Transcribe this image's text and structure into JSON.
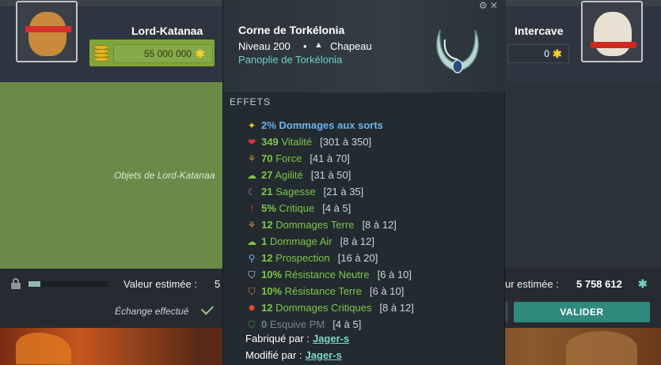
{
  "left_player": {
    "name": "Lord-Katanaa",
    "kamas": "55 000 000",
    "panel_label": "Objets de Lord-Katanaa",
    "value_label": "Valeur estimée :",
    "value_partial": "5",
    "status": "Échange effectué",
    "progress_fraction": 0.15
  },
  "right_player": {
    "name": "Intercave",
    "kamas": "0",
    "value_label": "ur estimée :",
    "value": "5 758 612"
  },
  "buttons": {
    "validate": "VALIDER"
  },
  "tooltip": {
    "controls": "⚙ ✕",
    "item_name": "Corne de Torkélonia",
    "level": "Niveau 200",
    "separator": "•",
    "type": "Chapeau",
    "set_name": "Panoplie de Torkélonia",
    "effects_title": "EFFETS",
    "effects": [
      {
        "icon": "star-icon",
        "value": "2%",
        "label": "Dommages aux sorts",
        "range": "",
        "style": "blue"
      },
      {
        "icon": "heart-icon",
        "value": "349",
        "label": "Vitalité",
        "range": "[301 à 350]",
        "style": "green"
      },
      {
        "icon": "earth-icon",
        "value": "70",
        "label": "Force",
        "range": "[41 à 70]",
        "style": "green"
      },
      {
        "icon": "air-icon",
        "value": "27",
        "label": "Agilité",
        "range": "[31 à 50]",
        "style": "green"
      },
      {
        "icon": "moon-icon",
        "value": "21",
        "label": "Sagesse",
        "range": "[21 à 35]",
        "style": "green"
      },
      {
        "icon": "critical-icon",
        "value": "5%",
        "label": "Critique",
        "range": "[4 à 5]",
        "style": "green"
      },
      {
        "icon": "earth-icon",
        "value": "12",
        "label": "Dommages Terre",
        "range": "[8 à 12]",
        "style": "green"
      },
      {
        "icon": "air-icon",
        "value": "1",
        "label": "Dommage Air",
        "range": "[8 à 12]",
        "style": "green"
      },
      {
        "icon": "magnifier-icon",
        "value": "12",
        "label": "Prospection",
        "range": "[16 à 20]",
        "style": "green"
      },
      {
        "icon": "neutral-shield-icon",
        "value": "10%",
        "label": "Résistance Neutre",
        "range": "[6 à 10]",
        "style": "green"
      },
      {
        "icon": "earth-shield-icon",
        "value": "10%",
        "label": "Résistance Terre",
        "range": "[6 à 10]",
        "style": "green"
      },
      {
        "icon": "critical-damage-icon",
        "value": "12",
        "label": "Dommages Critiques",
        "range": "[8 à 12]",
        "style": "green"
      },
      {
        "icon": "dodge-icon",
        "value": "0",
        "label": "Esquive PM",
        "range": "[4 à 5]",
        "style": "grey"
      }
    ],
    "crafted_label": "Fabriqué par :",
    "crafted_by": "Jager-s",
    "modified_label": "Modifié par :",
    "modified_by": "Jager-s"
  },
  "colors": {
    "green_stat": "#7ec64a",
    "blue_stat": "#6db2ee",
    "set_name": "#6fd1c7",
    "validate_button": "#2f8a7c",
    "kamas_panel": "#7fa63a"
  }
}
